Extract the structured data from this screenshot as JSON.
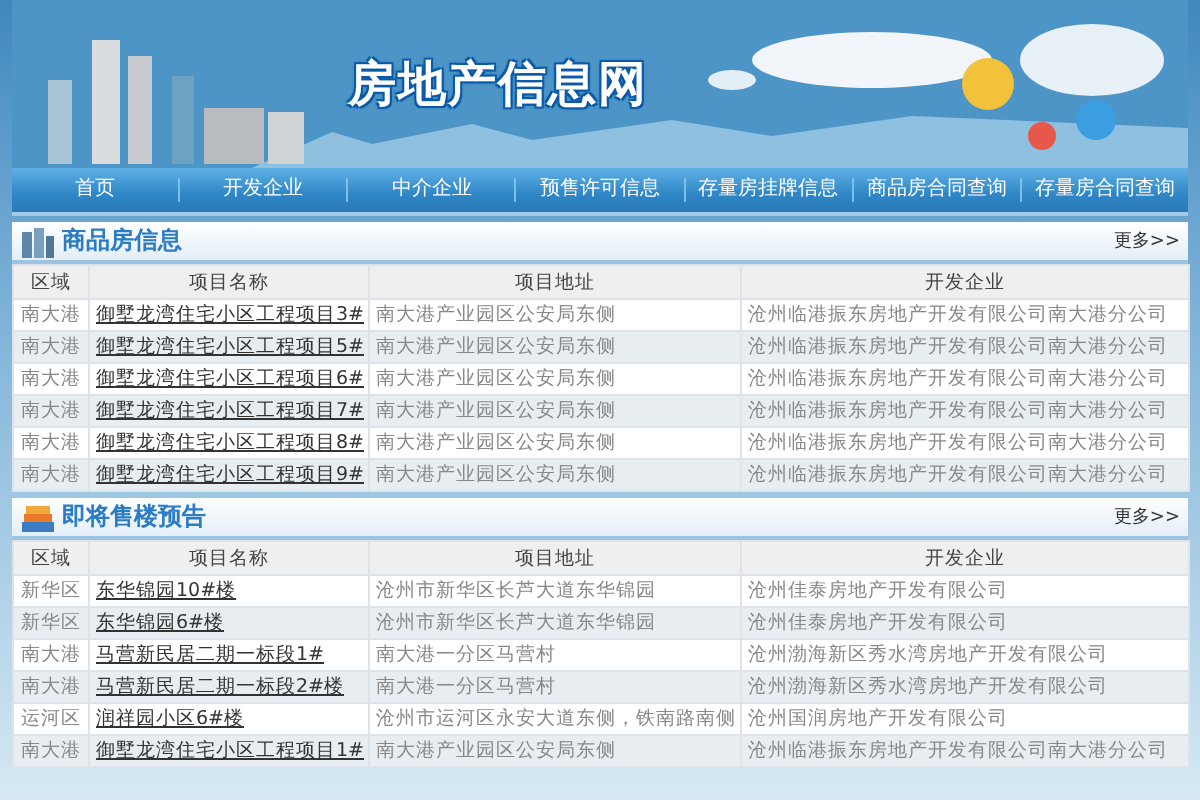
{
  "site_title": "房地产信息网",
  "nav": [
    "首页",
    "开发企业",
    "中介企业",
    "预售许可信息",
    "存量房挂牌信息",
    "商品房合同查询",
    "存量房合同查询"
  ],
  "sections": [
    {
      "title": "商品房信息",
      "more": "更多>>",
      "columns": [
        "区域",
        "项目名称",
        "项目地址",
        "开发企业"
      ],
      "rows": [
        [
          "南大港",
          "御墅龙湾住宅小区工程项目3#",
          "南大港产业园区公安局东侧",
          "沧州临港振东房地产开发有限公司南大港分公司"
        ],
        [
          "南大港",
          "御墅龙湾住宅小区工程项目5#",
          "南大港产业园区公安局东侧",
          "沧州临港振东房地产开发有限公司南大港分公司"
        ],
        [
          "南大港",
          "御墅龙湾住宅小区工程项目6#",
          "南大港产业园区公安局东侧",
          "沧州临港振东房地产开发有限公司南大港分公司"
        ],
        [
          "南大港",
          "御墅龙湾住宅小区工程项目7#",
          "南大港产业园区公安局东侧",
          "沧州临港振东房地产开发有限公司南大港分公司"
        ],
        [
          "南大港",
          "御墅龙湾住宅小区工程项目8#",
          "南大港产业园区公安局东侧",
          "沧州临港振东房地产开发有限公司南大港分公司"
        ],
        [
          "南大港",
          "御墅龙湾住宅小区工程项目9#",
          "南大港产业园区公安局东侧",
          "沧州临港振东房地产开发有限公司南大港分公司"
        ]
      ]
    },
    {
      "title": "即将售楼预告",
      "more": "更多>>",
      "columns": [
        "区域",
        "项目名称",
        "项目地址",
        "开发企业"
      ],
      "rows": [
        [
          "新华区",
          "东华锦园10#楼",
          "沧州市新华区长芦大道东华锦园",
          "沧州佳泰房地产开发有限公司"
        ],
        [
          "新华区",
          "东华锦园6#楼",
          "沧州市新华区长芦大道东华锦园",
          "沧州佳泰房地产开发有限公司"
        ],
        [
          "南大港",
          "马营新民居二期一标段1#",
          "南大港一分区马营村",
          "沧州渤海新区秀水湾房地产开发有限公司"
        ],
        [
          "南大港",
          "马营新民居二期一标段2#楼",
          "南大港一分区马营村",
          "沧州渤海新区秀水湾房地产开发有限公司"
        ],
        [
          "运河区",
          "润祥园小区6#楼",
          "沧州市运河区永安大道东侧，铁南路南侧",
          "沧州国润房地产开发有限公司"
        ],
        [
          "南大港",
          "御墅龙湾住宅小区工程项目1#",
          "南大港产业园区公安局东侧",
          "沧州临港振东房地产开发有限公司南大港分公司"
        ]
      ]
    }
  ]
}
